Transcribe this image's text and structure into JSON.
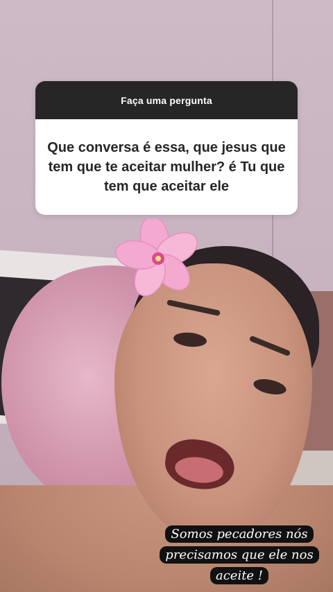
{
  "question_sticker": {
    "header": "Faça uma pergunta",
    "question": "Que conversa é essa, que jesus que tem que te aceitar mulher? é Tu que tem que aceitar ele"
  },
  "caption": {
    "text": "Somos pecadores nós precisamos que ele nos aceite !"
  },
  "colors": {
    "card_header_bg": "#262626",
    "card_body_bg": "#ffffff",
    "caption_bg": "#111111",
    "caption_text": "#ffffff"
  }
}
